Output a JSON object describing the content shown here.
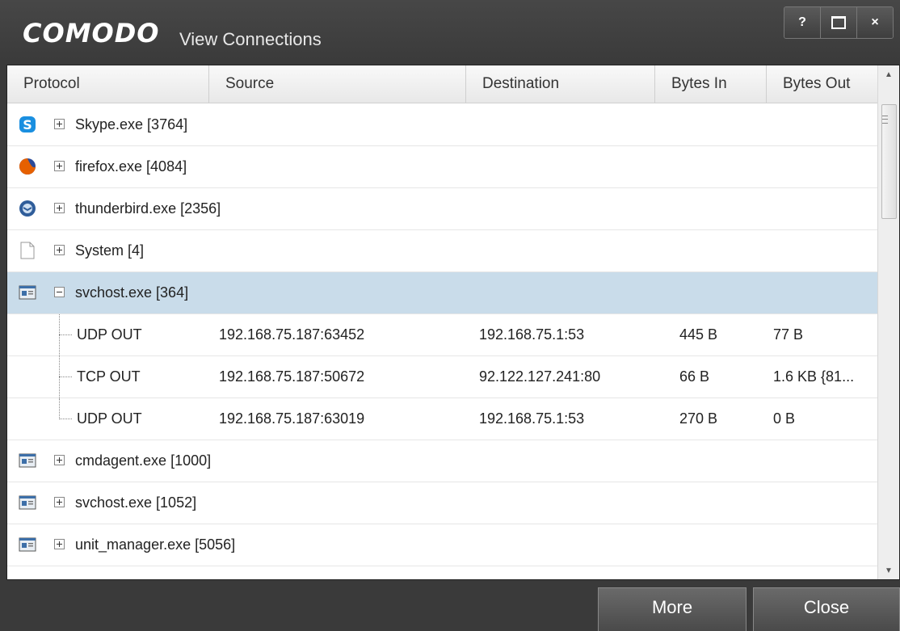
{
  "window": {
    "brand": "COMODO",
    "title": "View Connections",
    "help_label": "?",
    "close_label": "×"
  },
  "columns": [
    "Protocol",
    "Source",
    "Destination",
    "Bytes In",
    "Bytes Out"
  ],
  "processes": [
    {
      "name": "Skype.exe [3764]",
      "icon": "skype-icon",
      "expanded": false
    },
    {
      "name": "firefox.exe [4084]",
      "icon": "firefox-icon",
      "expanded": false
    },
    {
      "name": "thunderbird.exe [2356]",
      "icon": "thunderbird-icon",
      "expanded": false
    },
    {
      "name": "System [4]",
      "icon": "document-icon",
      "expanded": false
    },
    {
      "name": "svchost.exe [364]",
      "icon": "application-icon",
      "expanded": true
    },
    {
      "name": "cmdagent.exe [1000]",
      "icon": "application-icon",
      "expanded": false
    },
    {
      "name": "svchost.exe [1052]",
      "icon": "application-icon",
      "expanded": false
    },
    {
      "name": "unit_manager.exe [5056]",
      "icon": "application-icon",
      "expanded": false
    }
  ],
  "connections": [
    {
      "protocol": "UDP OUT",
      "source": "192.168.75.187:63452",
      "destination": "192.168.75.1:53",
      "bytes_in": "445 B",
      "bytes_out": "77 B"
    },
    {
      "protocol": "TCP OUT",
      "source": "192.168.75.187:50672",
      "destination": "92.122.127.241:80",
      "bytes_in": "66 B",
      "bytes_out": "1.6 KB {81..."
    },
    {
      "protocol": "UDP OUT",
      "source": "192.168.75.187:63019",
      "destination": "192.168.75.1:53",
      "bytes_in": "270 B",
      "bytes_out": "0 B"
    }
  ],
  "buttons": {
    "more": "More",
    "close": "Close"
  },
  "colors": {
    "selected_row": "#c9dcea",
    "titlebar": "#404040"
  }
}
